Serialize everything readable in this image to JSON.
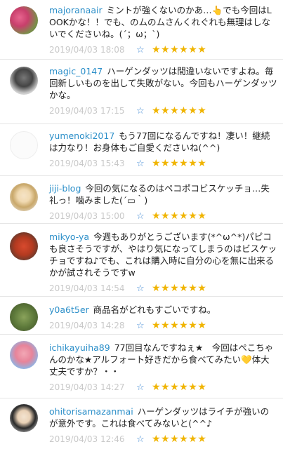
{
  "comments": [
    {
      "user": "majoranaair",
      "text": "ミントが強くないのかあ…👆でも今回はLOOKかな！！でも、のムのムさんくれぐれも無理はしないでくださいね。(´；ω；`)",
      "date": "2019/04/03 18:08",
      "rating": 5,
      "avatar": "flowers"
    },
    {
      "user": "magic_0147",
      "text": "ハーゲンダッツは間違いないですよね。毎回新しいものを出して失敗がない。今回もハーゲンダッツかな。",
      "date": "2019/04/03 17:15",
      "rating": 5,
      "avatar": "person-bw"
    },
    {
      "user": "yumenoki2017",
      "text": "もう77回になるんですね！凄い！継続は力なり！お身体もご自愛くださいね(^^)",
      "date": "2019/04/03 15:43",
      "rating": 5,
      "avatar": "sketch-rabbit"
    },
    {
      "user": "jiji-blog",
      "text": "今回の気になるのはペコポコビスケッチョ…失礼っ！噛みました(´▭｀)",
      "date": "2019/04/03 15:00",
      "rating": 5,
      "avatar": "anime-girl"
    },
    {
      "user": "mikyo-ya",
      "text": "今週もありがとうございます(*^ω^*)パピコも良さそうですが、やはり気になってしまうのはビスケッチョですね♪でも、これは購入時に自分の心を無に出来るかが試されそうですw",
      "date": "2019/04/03 14:54",
      "rating": 5,
      "avatar": "food-red"
    },
    {
      "user": "y0a6t5er",
      "text": "商品名がどれもすごいですね。",
      "date": "2019/04/03 14:28",
      "rating": 5,
      "avatar": "food-green"
    },
    {
      "user": "ichikayuiha89",
      "text": "77回目なんですねぇ★　今回はぺこちゃんのかな★アルフォート好きだから食べてみたい💛体大丈夫ですか？・・",
      "date": "2019/04/03 14:27",
      "rating": 5,
      "avatar": "bear-pink"
    },
    {
      "user": "ohitorisamazanmai",
      "text": "ハーゲンダッツはライチが強いのが意外です。これは食べてみないと(^^♪",
      "date": "2019/04/03 12:46",
      "rating": 5,
      "avatar": "anime-dark"
    }
  ],
  "icons": {
    "heart": "heart-outline-icon",
    "star": "star-icon"
  },
  "colors": {
    "username": "#2c8fc9",
    "date": "#c9c9c9",
    "star": "#f0b400",
    "heart": "#4a8fd6"
  }
}
